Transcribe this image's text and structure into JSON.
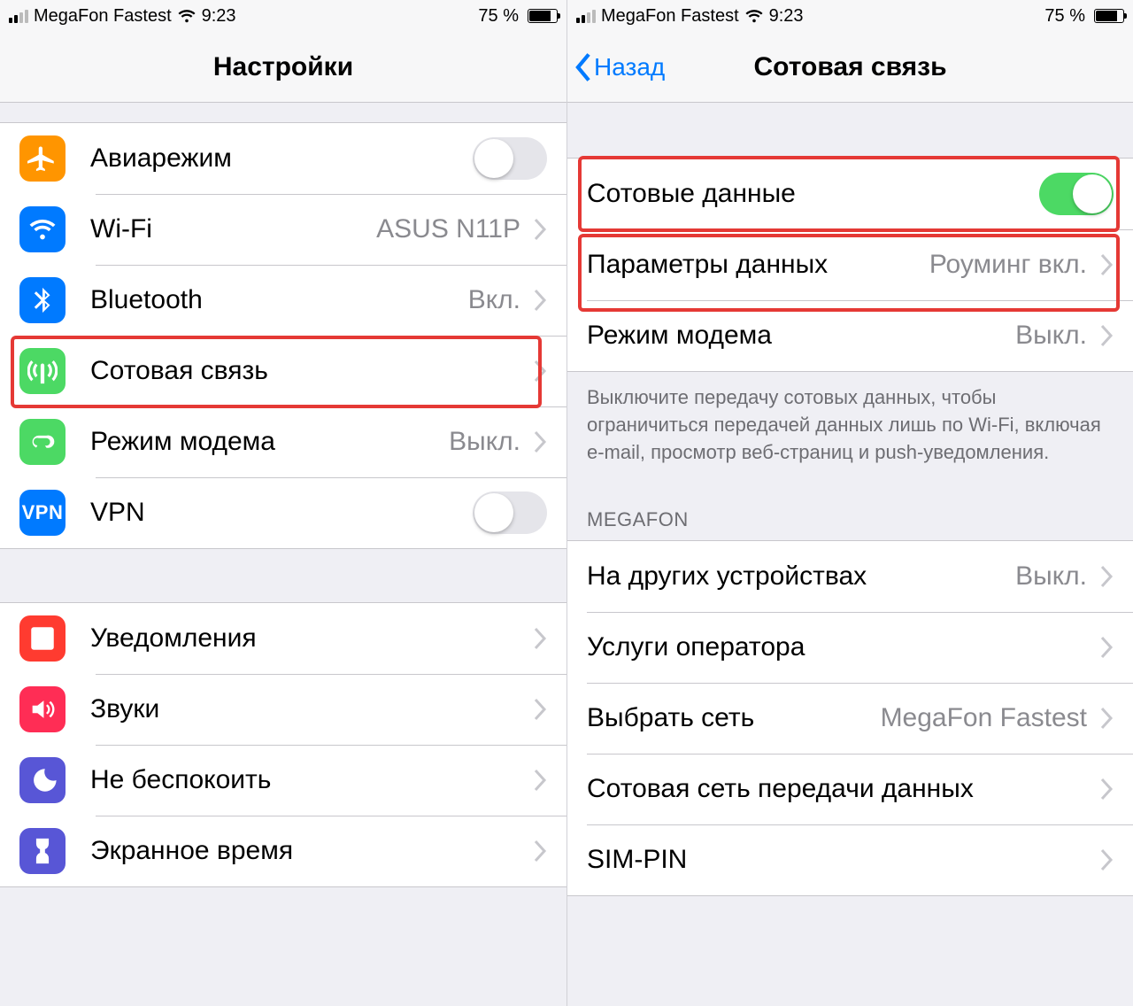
{
  "status": {
    "carrier": "MegaFon Fastest",
    "time": "9:23",
    "battery_pct": "75 %"
  },
  "left": {
    "title": "Настройки",
    "rows": {
      "airplane": {
        "label": "Авиарежим"
      },
      "wifi": {
        "label": "Wi-Fi",
        "value": "ASUS N11P"
      },
      "bluetooth": {
        "label": "Bluetooth",
        "value": "Вкл."
      },
      "cellular": {
        "label": "Сотовая связь"
      },
      "hotspot": {
        "label": "Режим модема",
        "value": "Выкл."
      },
      "vpn": {
        "label": "VPN"
      },
      "notif": {
        "label": "Уведомления"
      },
      "sounds": {
        "label": "Звуки"
      },
      "dnd": {
        "label": "Не беспокоить"
      },
      "screentime": {
        "label": "Экранное время"
      }
    }
  },
  "right": {
    "back": "Назад",
    "title": "Сотовая связь",
    "rows": {
      "cell_data": {
        "label": "Сотовые данные"
      },
      "data_params": {
        "label": "Параметры данных",
        "value": "Роуминг вкл."
      },
      "hotspot": {
        "label": "Режим модема",
        "value": "Выкл."
      }
    },
    "footer1": "Выключите передачу сотовых данных, чтобы ограничиться передачей данных лишь по Wi-Fi, включая e-mail, просмотр веб-страниц и push-уведомления.",
    "section_header": "MEGAFON",
    "rows2": {
      "other_devices": {
        "label": "На других устройствах",
        "value": "Выкл."
      },
      "carrier_services": {
        "label": "Услуги оператора"
      },
      "select_network": {
        "label": "Выбрать сеть",
        "value": "MegaFon Fastest"
      },
      "apn": {
        "label": "Сотовая сеть передачи данных"
      },
      "sim_pin": {
        "label": "SIM-PIN"
      }
    }
  },
  "colors": {
    "orange": "#ff9500",
    "blue": "#007aff",
    "green": "#4cd964",
    "green2": "#34c759",
    "red": "#ff3b30",
    "pink": "#ff2d55",
    "indigo": "#5856d6"
  }
}
